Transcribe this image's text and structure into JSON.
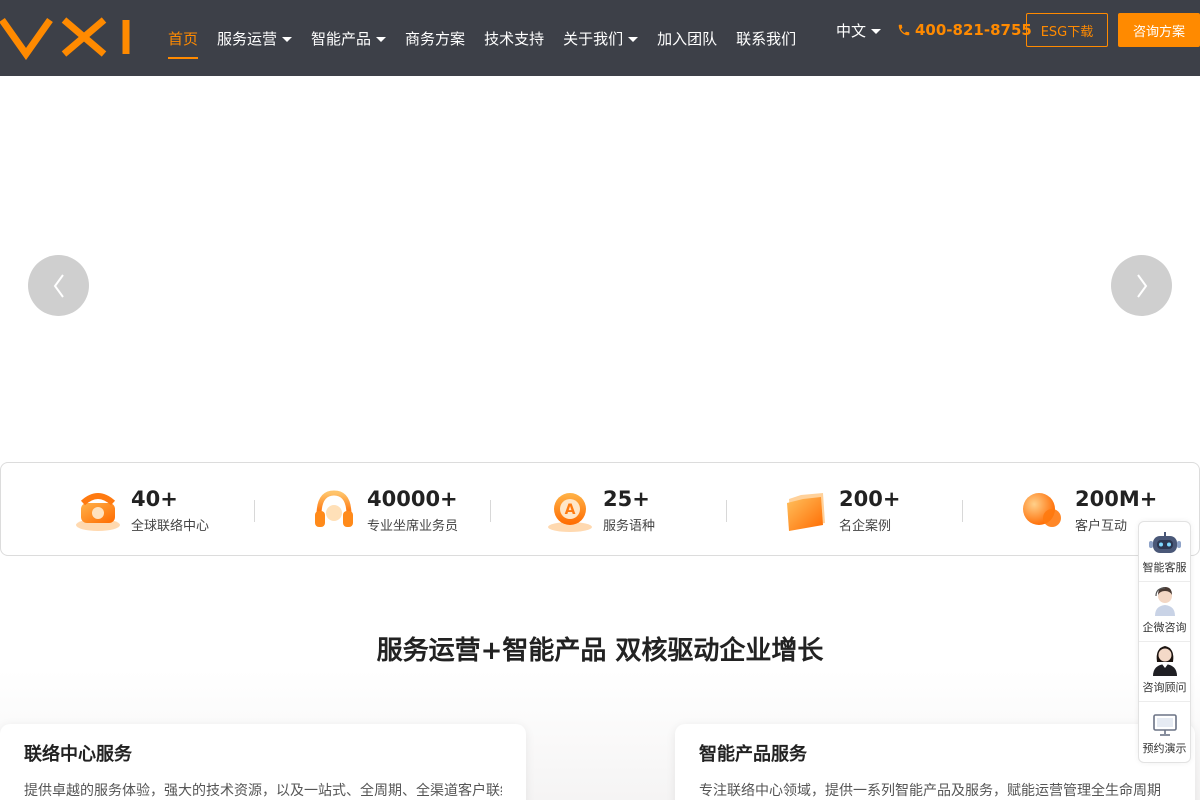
{
  "header": {
    "logo_text": "VXI",
    "nav": [
      {
        "label": "首页",
        "active": true,
        "dropdown": false
      },
      {
        "label": "服务运营",
        "active": false,
        "dropdown": true
      },
      {
        "label": "智能产品",
        "active": false,
        "dropdown": true
      },
      {
        "label": "商务方案",
        "active": false,
        "dropdown": false
      },
      {
        "label": "技术支持",
        "active": false,
        "dropdown": false
      },
      {
        "label": "关于我们",
        "active": false,
        "dropdown": true
      },
      {
        "label": "加入团队",
        "active": false,
        "dropdown": false
      },
      {
        "label": "联系我们",
        "active": false,
        "dropdown": false
      }
    ],
    "language": "中文",
    "phone": "400-821-8755",
    "esg_label": "ESG下载",
    "consult_label": "咨询方案"
  },
  "stats": [
    {
      "value": "40+",
      "label": "全球联络中心",
      "icon": "telephone-icon"
    },
    {
      "value": "40000+",
      "label": "专业坐席业务员",
      "icon": "headset-icon"
    },
    {
      "value": "25+",
      "label": "服务语种",
      "icon": "language-icon"
    },
    {
      "value": "200+",
      "label": "名企案例",
      "icon": "folder-icon"
    },
    {
      "value": "200M+",
      "label": "客户互动",
      "icon": "interaction-icon"
    }
  ],
  "section": {
    "title": "服务运营+智能产品 双核驱动企业增长",
    "cards": [
      {
        "title": "联络中心服务",
        "desc": "提供卓越的服务体验，强大的技术资源，以及一站式、全周期、全渠道客户联络解决方案"
      },
      {
        "title": "智能产品服务",
        "desc": "专注联络中心领域，提供一系列智能产品及服务，赋能运营管理全生命周期"
      }
    ]
  },
  "sidebar": [
    {
      "label": "智能客服",
      "icon": "robot-icon"
    },
    {
      "label": "企微咨询",
      "icon": "agent-avatar-icon"
    },
    {
      "label": "咨询顾问",
      "icon": "consultant-avatar-icon"
    },
    {
      "label": "预约演示",
      "icon": "monitor-icon"
    }
  ],
  "colors": {
    "header_bg": "#3d4048",
    "accent": "#ff8a00"
  }
}
